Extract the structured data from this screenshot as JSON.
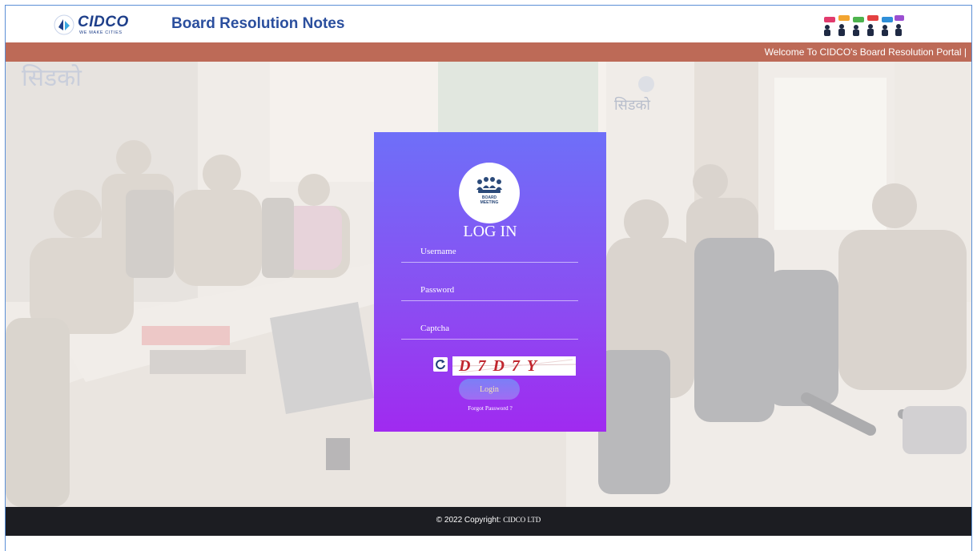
{
  "header": {
    "logo_text": "CIDCO",
    "logo_tagline": "WE MAKE CITIES",
    "app_title": "Board Resolution Notes"
  },
  "marquee": {
    "text": "Welcome To CIDCO's Board Resolution Portal |"
  },
  "hero": {
    "background_sign_text": "सिडको"
  },
  "login": {
    "avatar_caption_line1": "BOARD",
    "avatar_caption_line2": "MEETING",
    "title": "LOG IN",
    "username_placeholder": "Username",
    "password_placeholder": "Password",
    "captcha_placeholder": "Captcha",
    "captcha_value": "D7D7Y",
    "login_label": "Login",
    "forgot_label": "Forgot Password ?"
  },
  "footer": {
    "copyright": "© 2022 Copyright:",
    "org": "CIDCO LTD"
  },
  "colors": {
    "title_blue": "#2b4f9e",
    "marquee_bar": "#bd6a57",
    "card_top": "#6e6ff8",
    "card_bottom": "#a02af0",
    "footer_bg": "#1c1d22"
  },
  "icons": [
    "cidco-logo-icon",
    "people-chat-icon",
    "board-meeting-icon",
    "refresh-icon"
  ]
}
